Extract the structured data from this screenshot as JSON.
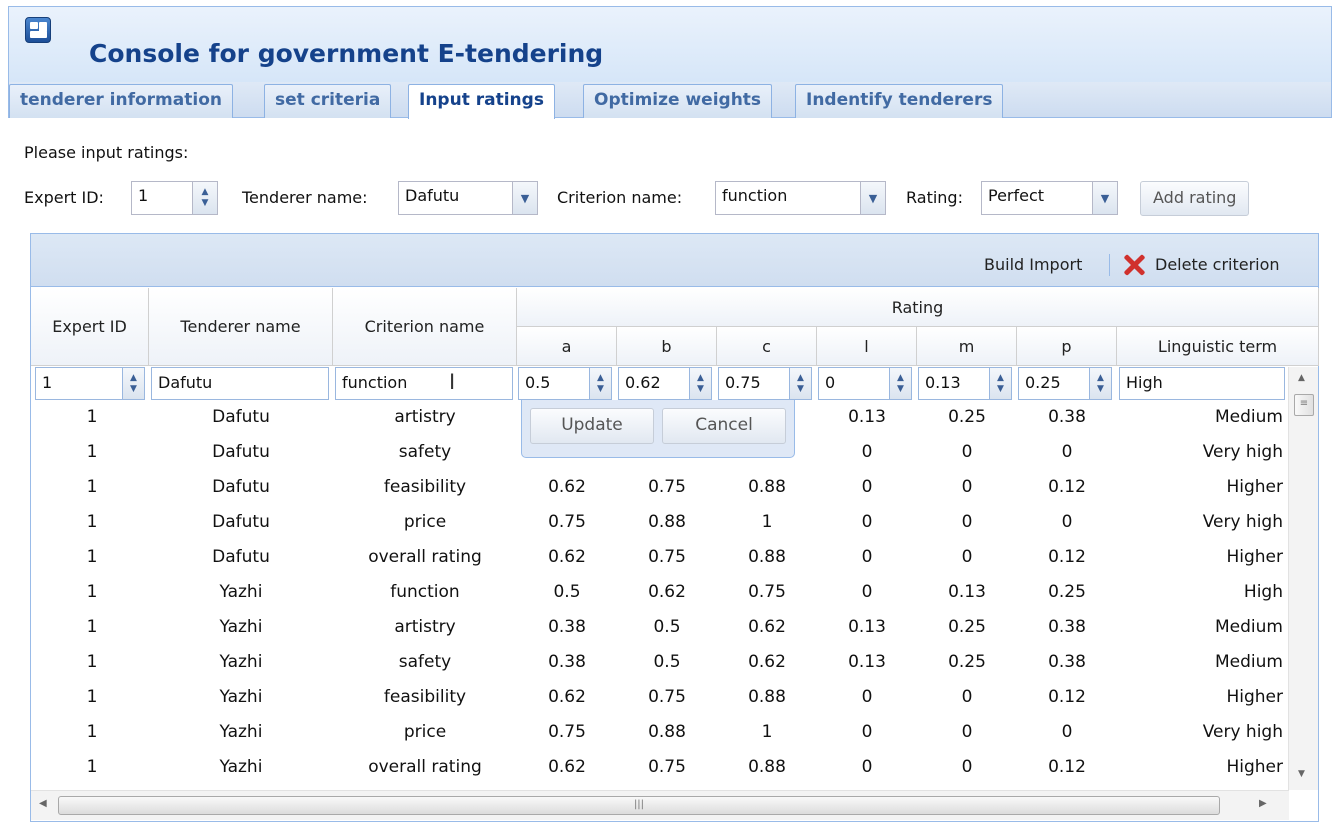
{
  "app": {
    "title": "Console for government E-tendering",
    "icon": "app-window-icon"
  },
  "tabs": [
    {
      "label": "tenderer information",
      "active": false
    },
    {
      "label": "set criteria",
      "active": false
    },
    {
      "label": "Input ratings",
      "active": true
    },
    {
      "label": "Optimize weights",
      "active": false
    },
    {
      "label": "Indentify tenderers",
      "active": false
    }
  ],
  "form": {
    "prompt": "Please input ratings:",
    "expert_label": "Expert ID:",
    "expert_value": "1",
    "tenderer_label": "Tenderer name:",
    "tenderer_value": "Dafutu",
    "criterion_label": "Criterion name:",
    "criterion_value": "function",
    "rating_label": "Rating:",
    "rating_value": "Perfect",
    "add_button": "Add rating"
  },
  "toolbar": {
    "build_import": "Build Import",
    "delete_criterion": "Delete criterion",
    "delete_icon": "red-x-icon"
  },
  "columns": {
    "expert_id": "Expert ID",
    "tenderer_name": "Tenderer name",
    "criterion_name": "Criterion name",
    "rating_group": "Rating",
    "a": "a",
    "b": "b",
    "c": "c",
    "l": "l",
    "m": "m",
    "p": "p",
    "linguistic_term": "Linguistic term"
  },
  "editor": {
    "expert": "1",
    "tenderer": "Dafutu",
    "criterion": "function",
    "a": "0.5",
    "b": "0.62",
    "c": "0.75",
    "l": "0",
    "m": "0.13",
    "p": "0.25",
    "term": "High",
    "update": "Update",
    "cancel": "Cancel"
  },
  "rows": [
    {
      "expert": "1",
      "tenderer": "Dafutu",
      "criterion": "artistry",
      "a": "",
      "b": "",
      "c": "",
      "l": "0.13",
      "m": "0.25",
      "p": "0.38",
      "term": "Medium"
    },
    {
      "expert": "1",
      "tenderer": "Dafutu",
      "criterion": "safety",
      "a": "",
      "b": "",
      "c": "",
      "l": "0",
      "m": "0",
      "p": "0",
      "term": "Very high"
    },
    {
      "expert": "1",
      "tenderer": "Dafutu",
      "criterion": "feasibility",
      "a": "0.62",
      "b": "0.75",
      "c": "0.88",
      "l": "0",
      "m": "0",
      "p": "0.12",
      "term": "Higher"
    },
    {
      "expert": "1",
      "tenderer": "Dafutu",
      "criterion": "price",
      "a": "0.75",
      "b": "0.88",
      "c": "1",
      "l": "0",
      "m": "0",
      "p": "0",
      "term": "Very high"
    },
    {
      "expert": "1",
      "tenderer": "Dafutu",
      "criterion": "overall rating",
      "a": "0.62",
      "b": "0.75",
      "c": "0.88",
      "l": "0",
      "m": "0",
      "p": "0.12",
      "term": "Higher"
    },
    {
      "expert": "1",
      "tenderer": "Yazhi",
      "criterion": "function",
      "a": "0.5",
      "b": "0.62",
      "c": "0.75",
      "l": "0",
      "m": "0.13",
      "p": "0.25",
      "term": "High"
    },
    {
      "expert": "1",
      "tenderer": "Yazhi",
      "criterion": "artistry",
      "a": "0.38",
      "b": "0.5",
      "c": "0.62",
      "l": "0.13",
      "m": "0.25",
      "p": "0.38",
      "term": "Medium"
    },
    {
      "expert": "1",
      "tenderer": "Yazhi",
      "criterion": "safety",
      "a": "0.38",
      "b": "0.5",
      "c": "0.62",
      "l": "0.13",
      "m": "0.25",
      "p": "0.38",
      "term": "Medium"
    },
    {
      "expert": "1",
      "tenderer": "Yazhi",
      "criterion": "feasibility",
      "a": "0.62",
      "b": "0.75",
      "c": "0.88",
      "l": "0",
      "m": "0",
      "p": "0.12",
      "term": "Higher"
    },
    {
      "expert": "1",
      "tenderer": "Yazhi",
      "criterion": "price",
      "a": "0.75",
      "b": "0.88",
      "c": "1",
      "l": "0",
      "m": "0",
      "p": "0",
      "term": "Very high"
    },
    {
      "expert": "1",
      "tenderer": "Yazhi",
      "criterion": "overall rating",
      "a": "0.62",
      "b": "0.75",
      "c": "0.88",
      "l": "0",
      "m": "0",
      "p": "0.12",
      "term": "Higher"
    }
  ]
}
